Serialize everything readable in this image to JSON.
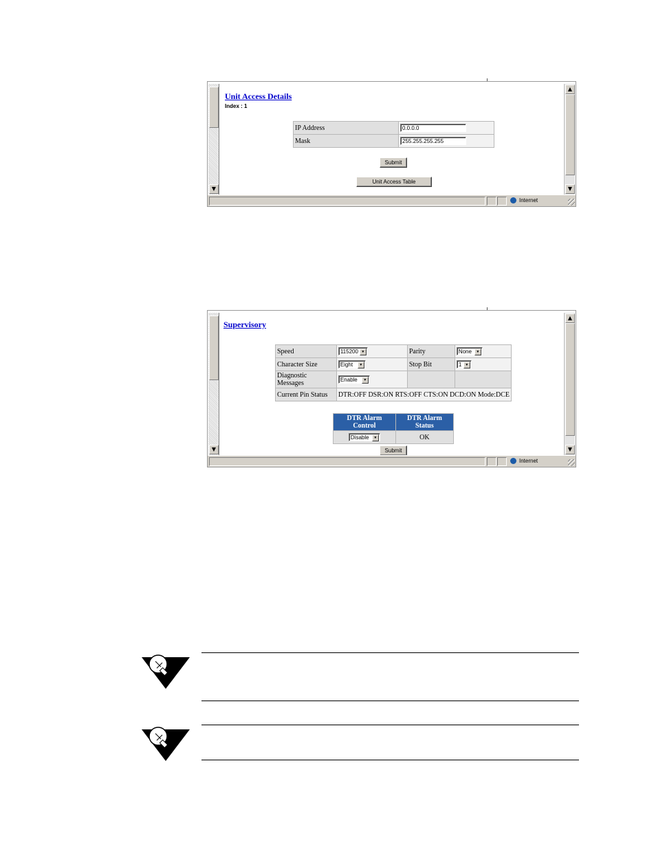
{
  "screen1": {
    "title": "Unit Access Details",
    "index_label": "Index : 1",
    "fields": [
      {
        "label": "IP Address",
        "value": "0.0.0.0"
      },
      {
        "label": "Mask",
        "value": "255.255.255.255"
      }
    ],
    "submit_label": "Submit",
    "table_button_label": "Unit Access Table",
    "status_zone": "Internet"
  },
  "screen2": {
    "title": "Supervisory",
    "rows": [
      {
        "label": "Speed",
        "value": "115200",
        "label2": "Parity",
        "value2": "None"
      },
      {
        "label": "Character Size",
        "value": "Eight",
        "label2": "Stop Bit",
        "value2": "1"
      },
      {
        "label": "Diagnostic Messages",
        "value": "Enable"
      },
      {
        "label": "Current Pin Status",
        "value": "DTR:OFF DSR:ON RTS:OFF CTS:ON DCD:ON Mode:DCE"
      }
    ],
    "alarm_headers": [
      "DTR Alarm Control",
      "DTR Alarm Status"
    ],
    "alarm_control_value": "Disable",
    "alarm_status_value": "OK",
    "submit_label": "Submit",
    "status_zone": "Internet"
  },
  "notes": [
    {
      "icon": "lightbulb-note-icon"
    },
    {
      "icon": "lightbulb-note-icon"
    }
  ]
}
